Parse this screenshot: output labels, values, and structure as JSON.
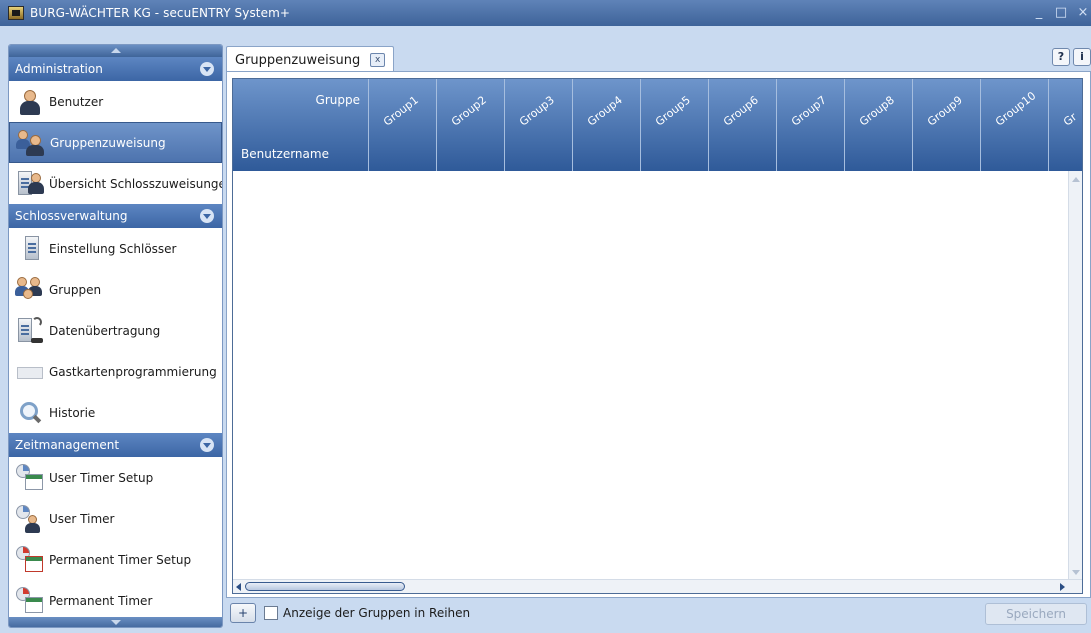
{
  "window": {
    "title": "BURG-WÄCHTER KG - secuENTRY System+",
    "minimize": "_",
    "maximize": "□",
    "close": "×"
  },
  "sidebar": {
    "sections": [
      {
        "label": "Administration",
        "items": [
          {
            "label": "Benutzer",
            "icon": "user-icon"
          },
          {
            "label": "Gruppenzuweisung",
            "icon": "group-assignment-icon",
            "active": true
          },
          {
            "label": "Übersicht Schlosszuweisunge",
            "icon": "lock-assignment-icon"
          }
        ]
      },
      {
        "label": "Schlossverwaltung",
        "items": [
          {
            "label": "Einstellung Schlösser",
            "icon": "lock-settings-icon"
          },
          {
            "label": "Gruppen",
            "icon": "groups-icon"
          },
          {
            "label": "Datenübertragung",
            "icon": "data-transfer-icon"
          },
          {
            "label": "Gastkartenprogrammierung",
            "icon": "guest-card-icon"
          },
          {
            "label": "Historie",
            "icon": "history-icon"
          }
        ]
      },
      {
        "label": "Zeitmanagement",
        "items": [
          {
            "label": "User Timer Setup",
            "icon": "user-timer-setup-icon"
          },
          {
            "label": "User Timer",
            "icon": "user-timer-icon"
          },
          {
            "label": "Permanent Timer Setup",
            "icon": "permanent-timer-setup-icon"
          },
          {
            "label": "Permanent Timer",
            "icon": "permanent-timer-icon"
          }
        ]
      }
    ]
  },
  "tab": {
    "label": "Gruppenzuweisung",
    "close": "x"
  },
  "help": {
    "question": "?",
    "info": "i"
  },
  "grid": {
    "corner_top": "Gruppe",
    "corner_bottom": "Benutzername",
    "columns": [
      "Group1",
      "Group2",
      "Group3",
      "Group4",
      "Group5",
      "Group6",
      "Group7",
      "Group8",
      "Group9",
      "Group10",
      "Gr"
    ]
  },
  "bottom": {
    "add": "+",
    "checkbox_label": "Anzeige der Gruppen in Reihen",
    "checked": false,
    "save": "Speichern"
  },
  "colors": {
    "header_blue": "#3c66a5",
    "active_item": "#4d73ae",
    "background": "#c9daf0"
  }
}
